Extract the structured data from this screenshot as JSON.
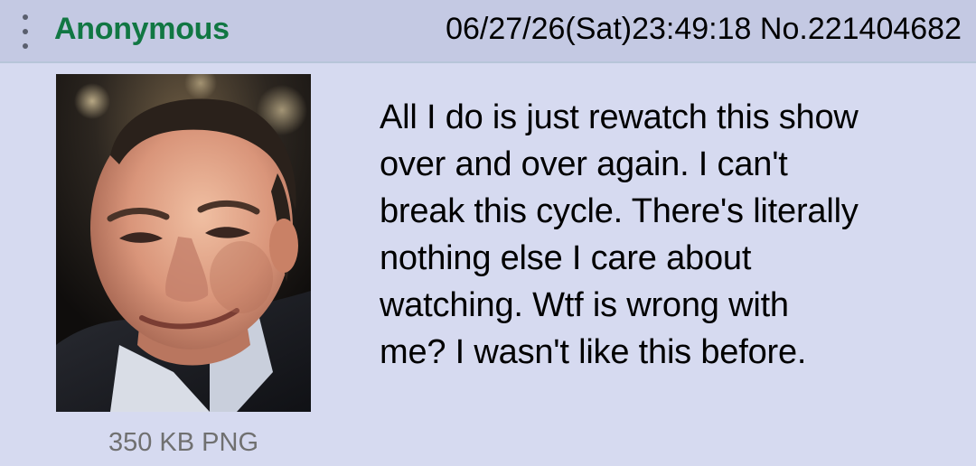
{
  "post": {
    "name": "Anonymous",
    "datetime": "06/27/26(Sat)23:49:18",
    "number": "No.221404682",
    "file_info": "350 KB PNG",
    "comment": "All I do is just rewatch this show\nover and over again. I can't\nbreak this cycle. There's literally\nnothing else I care about\nwatching. Wtf is wrong with\nme? I wasn't like this before."
  },
  "icons": {
    "menu": "more-vertical-icon"
  },
  "colors": {
    "background": "#d6daf0",
    "header_background": "#c4c9e3",
    "name": "#117743",
    "file_info": "#707070"
  }
}
